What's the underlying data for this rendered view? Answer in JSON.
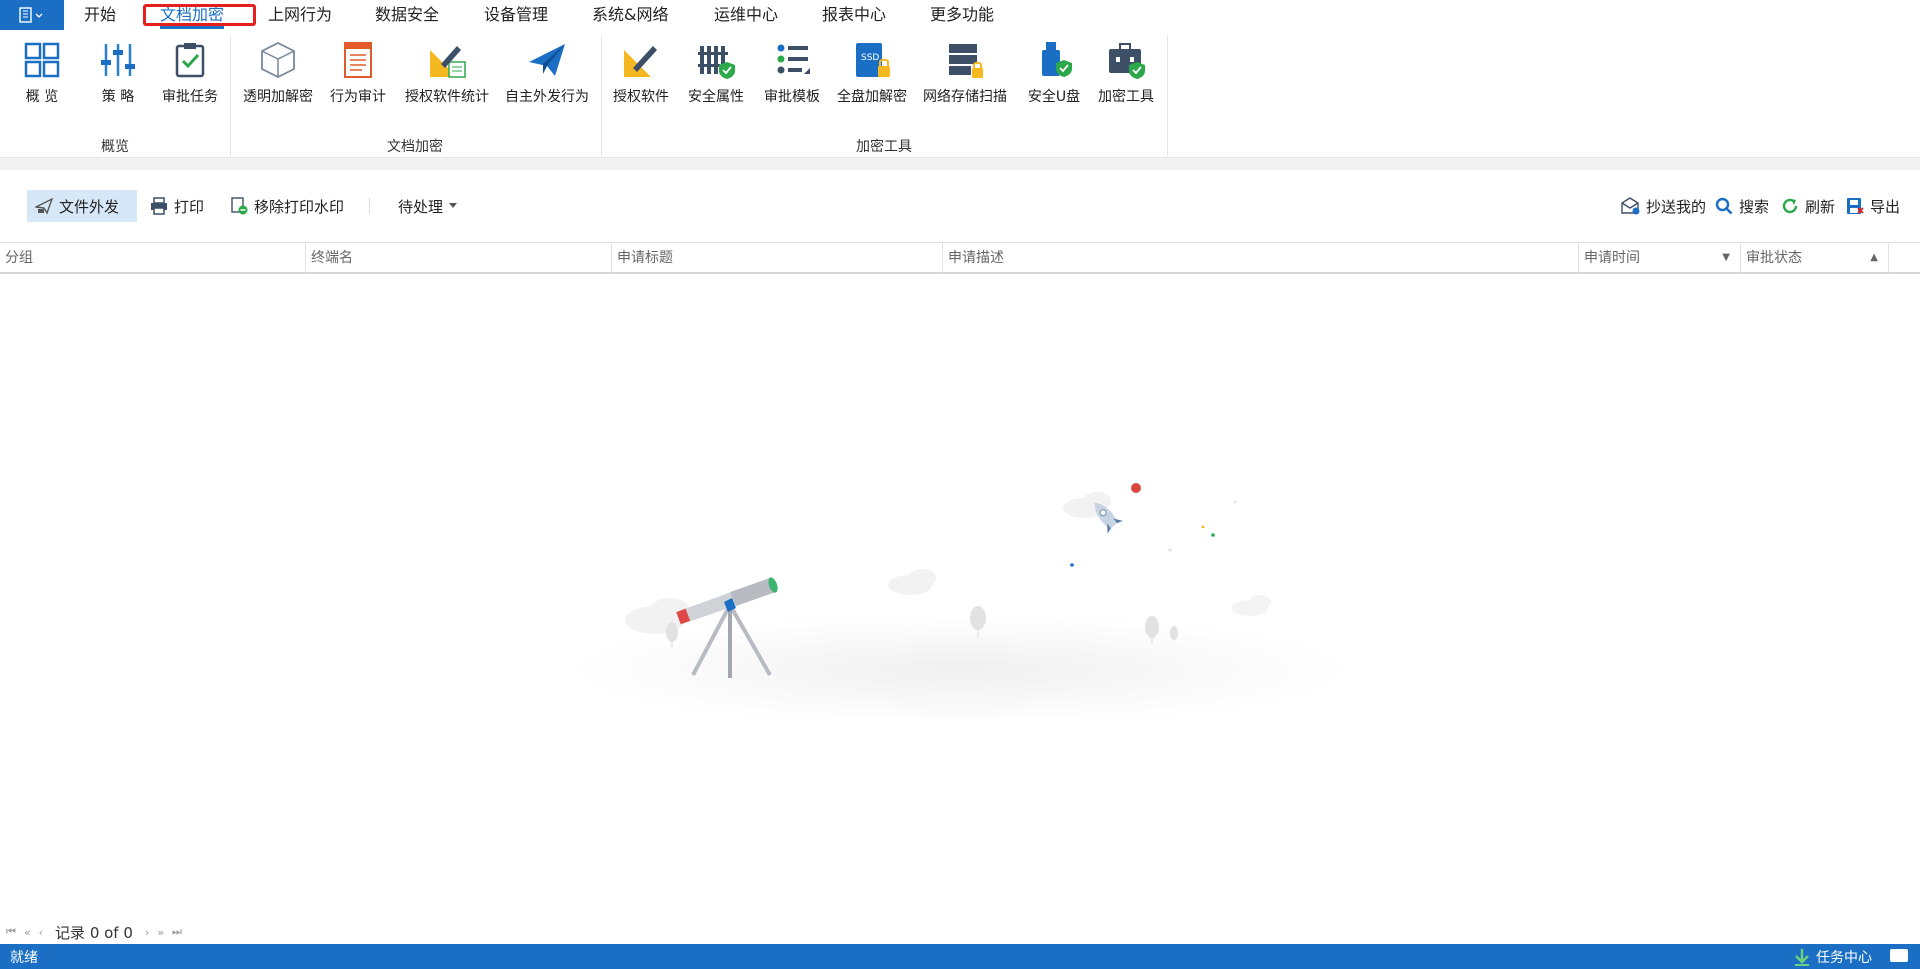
{
  "menu": {
    "tabs": [
      {
        "label": "开始"
      },
      {
        "label": "文档加密",
        "active": true
      },
      {
        "label": "上网行为"
      },
      {
        "label": "数据安全"
      },
      {
        "label": "设备管理"
      },
      {
        "label": "系统&网络"
      },
      {
        "label": "运维中心"
      },
      {
        "label": "报表中心"
      },
      {
        "label": "更多功能"
      }
    ]
  },
  "ribbon": {
    "groups": [
      {
        "label": "概览",
        "items": [
          {
            "label": "概 览",
            "icon": "grid-icon"
          },
          {
            "label": "策 略",
            "icon": "sliders-icon"
          },
          {
            "label": "审批任务",
            "icon": "clipboard-check-icon"
          }
        ]
      },
      {
        "label": "文档加密",
        "items": [
          {
            "label": "透明加解密",
            "icon": "cube-icon"
          },
          {
            "label": "行为审计",
            "icon": "document-list-icon"
          },
          {
            "label": "授权软件统计",
            "icon": "pencil-chart-icon"
          },
          {
            "label": "自主外发行为",
            "icon": "paper-plane-icon"
          }
        ]
      },
      {
        "label": "加密工具",
        "items": [
          {
            "label": "授权软件",
            "icon": "pencil-ruler-icon"
          },
          {
            "label": "安全属性",
            "icon": "fence-shield-icon"
          },
          {
            "label": "审批模板",
            "icon": "user-list-icon"
          },
          {
            "label": "全盘加解密",
            "icon": "ssd-lock-icon"
          },
          {
            "label": "网络存储扫描",
            "icon": "server-lock-icon"
          },
          {
            "label": "安全U盘",
            "icon": "usb-shield-icon"
          },
          {
            "label": "加密工具",
            "icon": "toolbox-shield-icon"
          }
        ]
      }
    ]
  },
  "toolbar": {
    "file_out": "文件外发",
    "print": "打印",
    "remove_watermark": "移除打印水印",
    "pending": "待处理",
    "cc_me": "抄送我的",
    "search": "搜索",
    "refresh": "刷新",
    "export": "导出"
  },
  "table": {
    "columns": [
      "分组",
      "终端名",
      "申请标题",
      "申请描述",
      "申请时间",
      "审批状态"
    ],
    "rows": []
  },
  "pager": {
    "record_text": "记录 0 of 0"
  },
  "status": {
    "left": "就绪",
    "task_center": "任务中心"
  },
  "colors": {
    "accent": "#1a6fc4",
    "highlight": "#e5201c",
    "toolbar_active": "#d6e8f7"
  }
}
